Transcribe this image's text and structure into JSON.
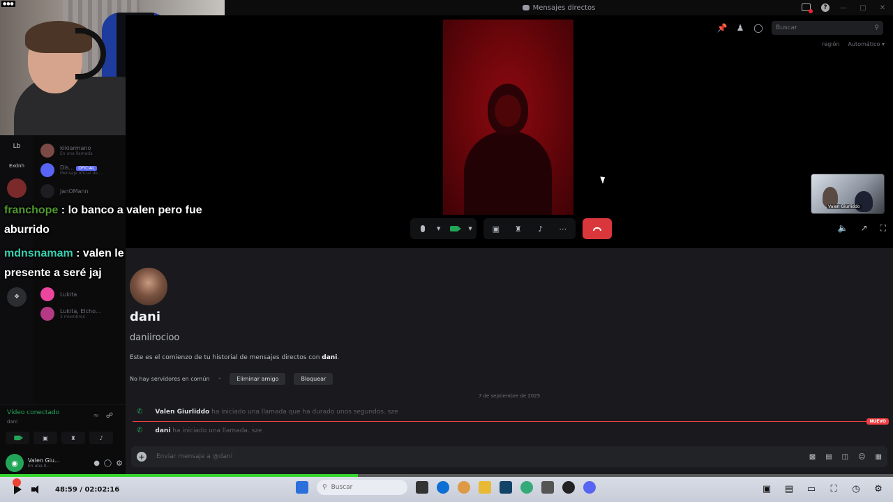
{
  "window": {
    "title": "Mensajes directos"
  },
  "call": {
    "search_placeholder": "Buscar",
    "region_label": "región",
    "region_value": "Automático",
    "pip_label": "Valen Giurliddo"
  },
  "sidebar": {
    "rail_items": [
      "Lb",
      "Exdnh"
    ],
    "dms": [
      {
        "name": "kikiarmano",
        "sub": "En una llamada"
      },
      {
        "name": "Dis...",
        "badge": "OFICIAL",
        "sub": "Mensaje oficial de ..."
      },
      {
        "name": "JanOMann",
        "sub": ""
      },
      {
        "name": "Lukita",
        "sub": ""
      },
      {
        "name": "Lukita, Elcho...",
        "sub": "3 miembros"
      }
    ],
    "voice": {
      "status": "Vídeo conectado",
      "sub": "dani"
    },
    "user": {
      "name": "Valen Giu...",
      "sub": "En una ll..."
    }
  },
  "stream_chat": [
    {
      "user": "franchope",
      "text": ": lo banco a valen pero fue aburrido"
    },
    {
      "user": "mdnsnamam",
      "text": ": valen le dijo que te presente a seré jaj"
    }
  ],
  "dm": {
    "display_name": "dani",
    "username": "daniirocioo",
    "intro_prefix": "Este es el comienzo de tu historial de mensajes directos con ",
    "intro_name": "dani",
    "intro_suffix": ".",
    "no_servers": "No hay servidores en común",
    "remove_friend": "Eliminar amigo",
    "block": "Bloquear",
    "date_divider": "7 de septiembre de 2025",
    "call_events": [
      {
        "who": "Valen Giurliddo",
        "what": "ha iniciado una llamada que ha durado unos segundos. sze"
      },
      {
        "who": "dani",
        "what": "ha iniciado una llamada. sze"
      }
    ],
    "new_badge": "NUEVO",
    "composer_placeholder": "Enviar mensaje a @dani"
  },
  "player": {
    "time": "48:59 / 02:02:16",
    "progress_fraction": 0.401,
    "progress_color": "#35d62e",
    "taskbar_search": "Buscar"
  },
  "colors": {
    "end_call": "#da373c",
    "online_green": "#23a559",
    "chat_user1": "#4e9a2e",
    "chat_user2": "#3ad1b0"
  }
}
